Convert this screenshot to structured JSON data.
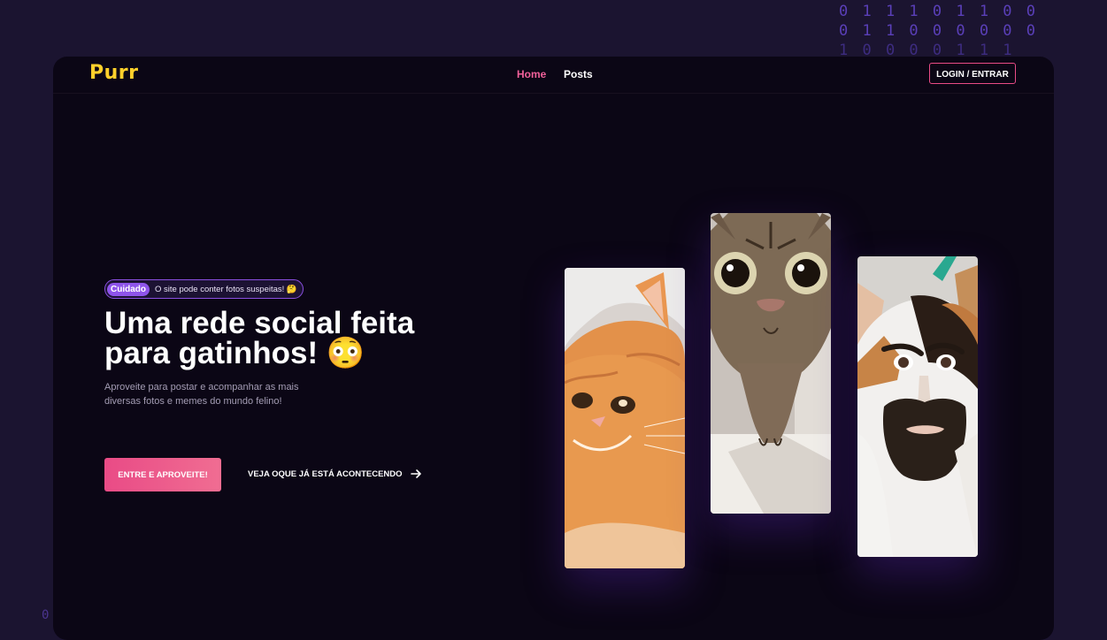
{
  "background_binary": [
    "0 1 1 1 0 1 1 0 0",
    "0 1 1 0 0 0 0 0 0",
    "1 0 0 0 0 1 1 1"
  ],
  "background_binary_stray": "0",
  "nav": {
    "logo": "Purr",
    "links": [
      {
        "label": "Home",
        "active": true,
        "color": "#f0609a"
      },
      {
        "label": "Posts",
        "active": false,
        "color": "#ffffff"
      }
    ],
    "login_label": "LOGIN / ENTRAR"
  },
  "hero": {
    "badge_tag": "Cuidado",
    "badge_text": "O site pode conter fotos suspeitas! 🤔",
    "title_line1": "Uma rede social feita",
    "title_line2": "para gatinhos! 😳",
    "subtitle": "Aproveite para postar e acompanhar as mais diversas fotos e memes do mundo felino!",
    "cta_label": "ENTRE E APROVEITE!",
    "secondary_label": "VEJA OQUE JÁ ESTÁ ACONTECENDO",
    "secondary_icon": "arrow-right-icon"
  },
  "cat_photos": [
    {
      "subject": "orange tabby cat close-up"
    },
    {
      "subject": "wide-eyed tabby kitten"
    },
    {
      "subject": "calico cat with face filter"
    }
  ],
  "colors": {
    "accent": "#e94b86",
    "logo": "#ffd02b",
    "badge": "#8e54ea",
    "page_bg": "#1b1430",
    "panel_bg": "#0b0615"
  }
}
